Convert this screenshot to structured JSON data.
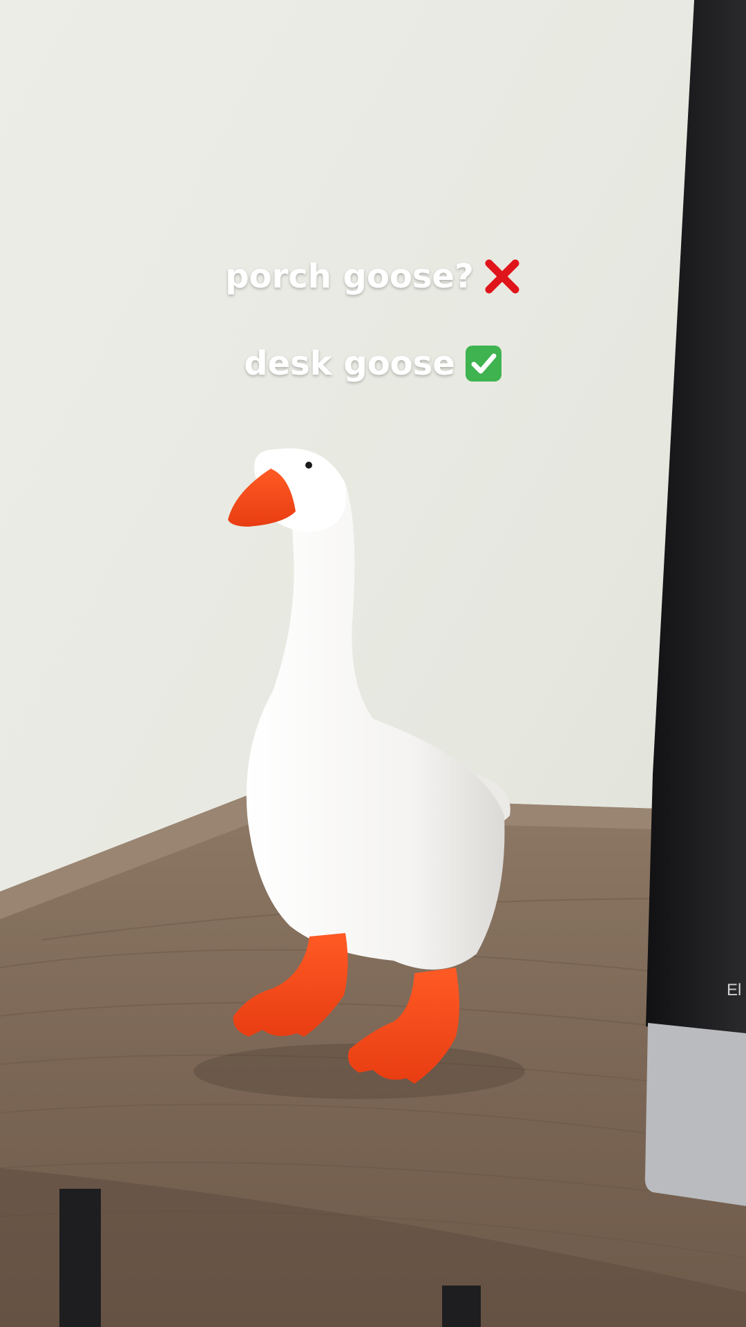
{
  "caption": {
    "line1": "porch goose?",
    "line2": "desk goose",
    "line1_emoji": "cross-mark-icon",
    "line2_emoji": "check-mark-button-icon"
  },
  "monitor": {
    "partial_label": "El"
  },
  "colors": {
    "wall": "#e9ebe4",
    "goose_body": "#f7f6f4",
    "goose_orange": "#f24a1c",
    "shelf_wood": "#8a7563",
    "monitor_black": "#1d1d1f",
    "check_green": "#3fb34f",
    "cross_red": "#e0141b"
  }
}
